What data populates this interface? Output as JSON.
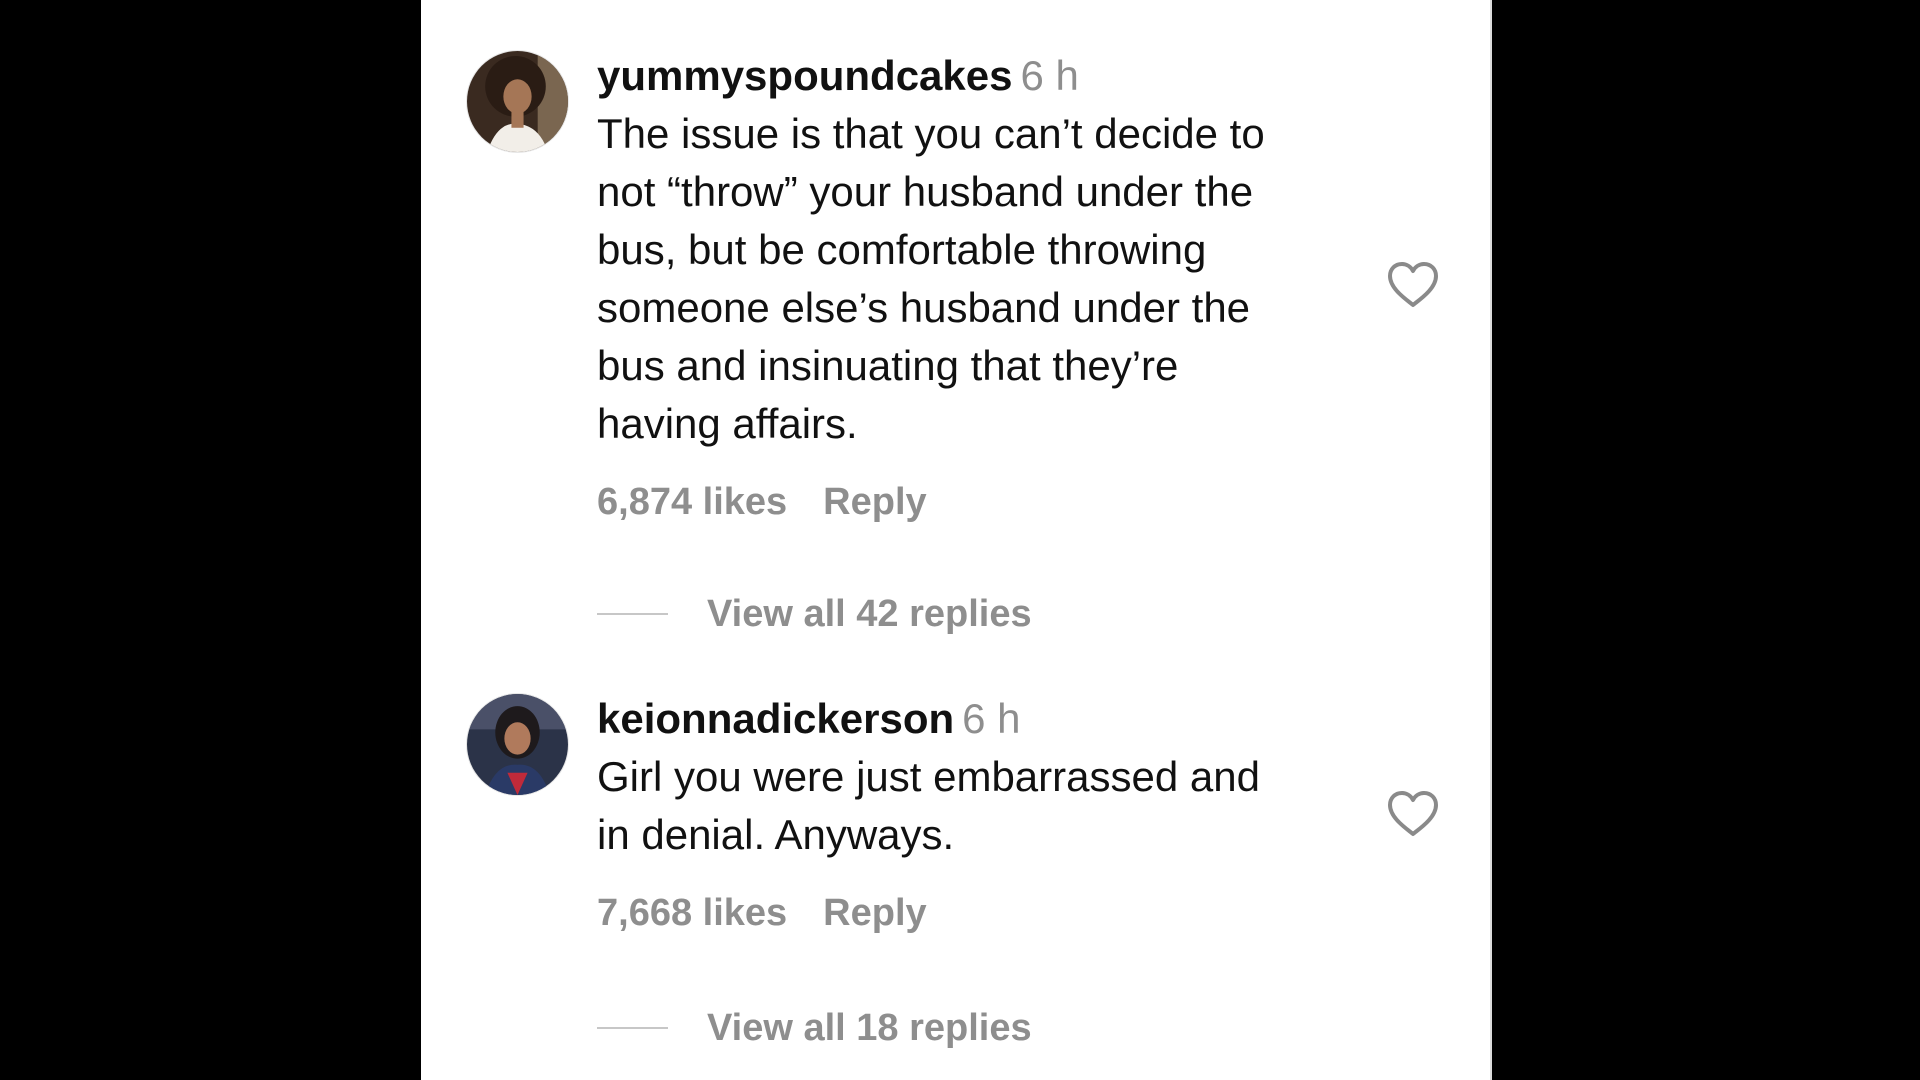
{
  "comments": [
    {
      "username": "yummyspoundcakes",
      "time": "6 h",
      "lines": [
        "The issue is that you can’t decide to",
        "not “throw” your husband under the",
        "bus, but be comfortable throwing",
        "someone else’s husband under the",
        "bus and insinuating that they’re",
        "having affairs."
      ],
      "likes": "6,874 likes",
      "reply_label": "Reply",
      "view_replies": "View all 42 replies"
    },
    {
      "username": "keionnadickerson",
      "time": "6 h",
      "lines": [
        "Girl you were just embarrassed and",
        "in denial. Anyways."
      ],
      "likes": "7,668 likes",
      "reply_label": "Reply",
      "view_replies": "View all 18 replies"
    }
  ],
  "colors": {
    "background": "#000000",
    "panel": "#ffffff",
    "text": "#111111",
    "secondary": "#8e8e8e"
  },
  "icons": {
    "like": "heart-outline-icon"
  }
}
